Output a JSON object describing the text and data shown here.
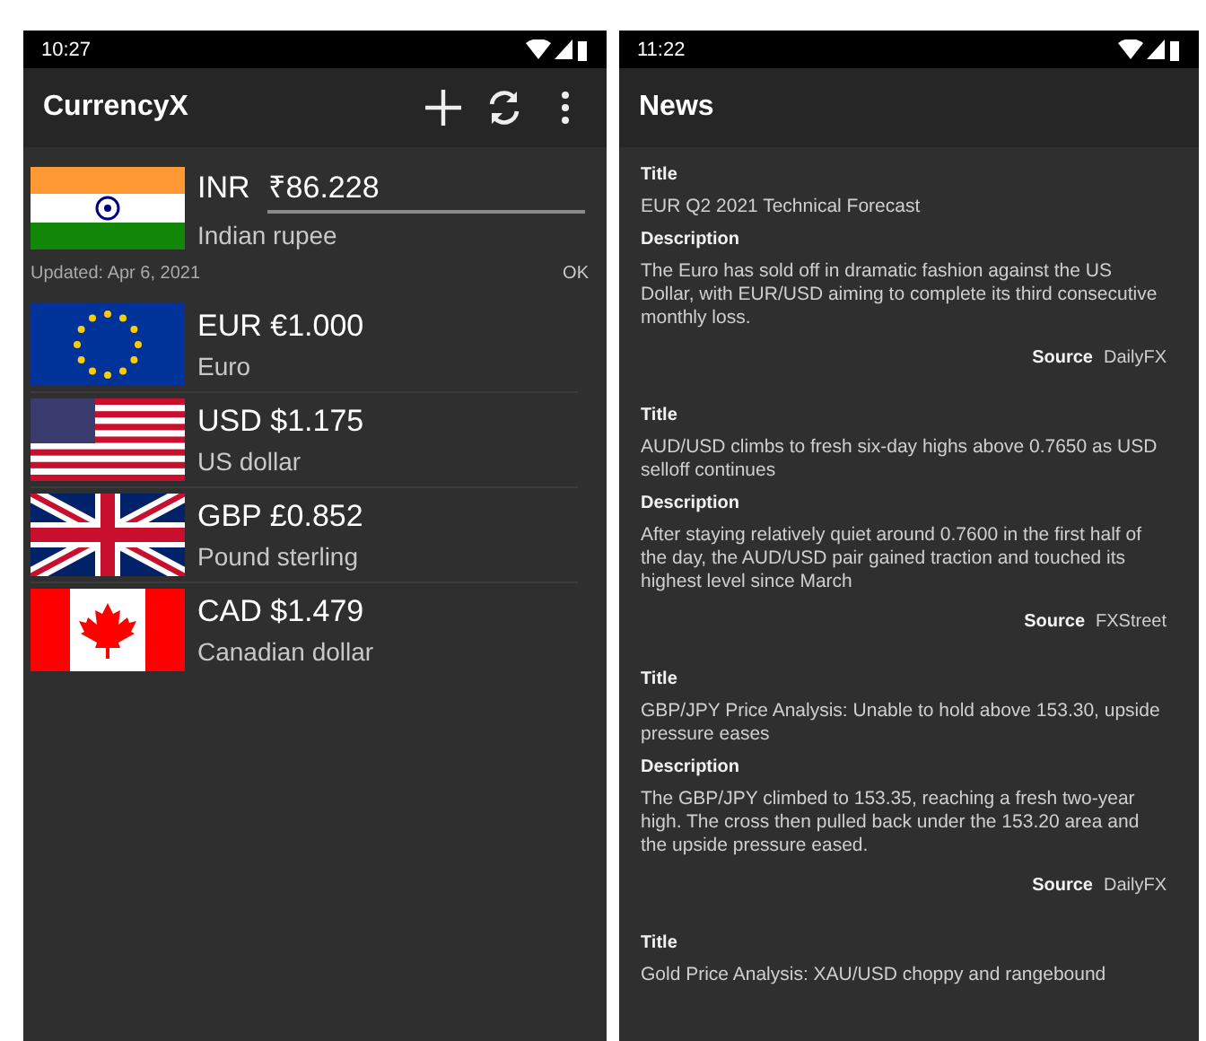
{
  "screens": [
    {
      "kind": "converter",
      "status_time": "10:27",
      "title": "CurrencyX",
      "actions": [
        {
          "kind": "add"
        },
        {
          "kind": "refresh"
        },
        {
          "kind": "more"
        }
      ],
      "base": {
        "code": "INR",
        "amount": "₹86.228",
        "name": "Indian rupee"
      },
      "updated": "Updated: Apr 6, 2021",
      "ok": "OK",
      "currencies": [
        {
          "code": "EUR",
          "amount": "€1.000",
          "name": "Euro"
        },
        {
          "code": "USD",
          "amount": "$1.175",
          "name": "US dollar"
        },
        {
          "code": "GBP",
          "amount": "£0.852",
          "name": "Pound sterling"
        },
        {
          "code": "CAD",
          "amount": "$1.479",
          "name": "Canadian dollar"
        }
      ]
    },
    {
      "kind": "news",
      "status_time": "11:22",
      "title": "News",
      "articles": [
        {
          "title_label": "Title",
          "title": "EUR Q2 2021 Technical Forecast",
          "description_label": "Description",
          "description": "The Euro has sold off in dramatic fashion against the US Dollar, with EUR/USD aiming to complete its third consecutive monthly loss.",
          "source_label": "Source",
          "source": "DailyFX"
        },
        {
          "title_label": "Title",
          "title": "AUD/USD climbs to fresh six-day highs above 0.7650 as USD selloff continues",
          "description_label": "Description",
          "description": "After staying relatively quiet around 0.7600 in the first half of the day, the AUD/USD pair gained traction and touched its highest level since March",
          "source_label": "Source",
          "source": "FXStreet"
        },
        {
          "title_label": "Title",
          "title": "GBP/JPY Price Analysis: Unable to hold above 153.30, upside pressure eases",
          "description_label": "Description",
          "description": "The GBP/JPY climbed to 153.35, reaching a fresh two-year high. The cross then pulled back under the 153.20 area and the upside pressure eased.",
          "source_label": "Source",
          "source": "DailyFX"
        },
        {
          "title_label": "Title",
          "title": "Gold Price Analysis: XAU/USD choppy and rangebound"
        }
      ]
    }
  ]
}
